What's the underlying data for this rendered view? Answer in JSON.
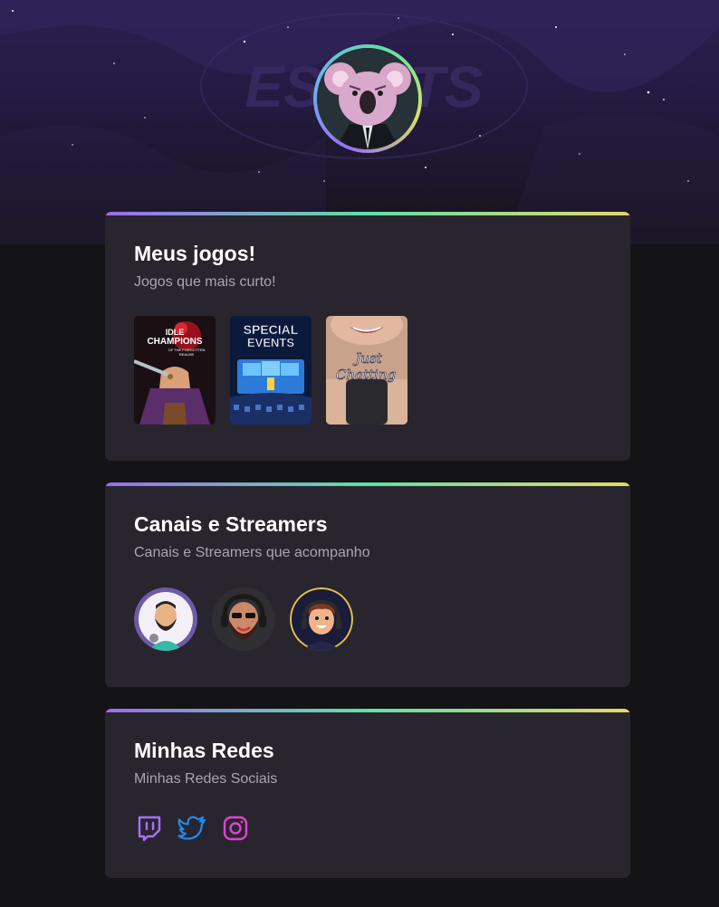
{
  "profile": {
    "avatar_icon": "koala-avatar"
  },
  "sections": {
    "games": {
      "title": "Meus jogos!",
      "subtitle": "Jogos que mais curto!",
      "items": [
        {
          "lines": [
            "IDLE",
            "CHAMPIONS",
            "OF THE FORGOTTEN",
            "REALMS"
          ]
        },
        {
          "lines": [
            "SPECIAL",
            "EVENTS"
          ]
        },
        {
          "lines": [
            "Just",
            "Chatting"
          ]
        }
      ]
    },
    "streamers": {
      "title": "Canais e Streamers",
      "subtitle": "Canais e Streamers que acompanho",
      "items": [
        {
          "icon": "streamer-avatar-purple"
        },
        {
          "icon": "streamer-avatar-dark"
        },
        {
          "icon": "streamer-avatar-gold"
        }
      ]
    },
    "socials": {
      "title": "Minhas Redes",
      "subtitle": "Minhas Redes Sociais",
      "items": [
        {
          "icon": "twitch-icon",
          "color": "#a970ff"
        },
        {
          "icon": "twitter-icon",
          "color": "#1d8cf0"
        },
        {
          "icon": "instagram-icon",
          "color": "#e142d6"
        }
      ]
    }
  }
}
